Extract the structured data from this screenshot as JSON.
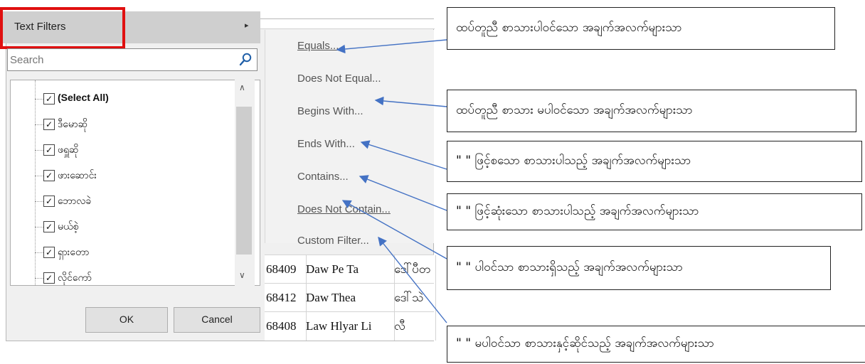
{
  "text_filters": {
    "label": "Text Filters",
    "arrow": "▸"
  },
  "search": {
    "placeholder": "Search"
  },
  "list_items": [
    {
      "label": "(Select All)",
      "checked": true
    },
    {
      "label": "ဒီမောဆို",
      "checked": true
    },
    {
      "label": "ဖရှူဆို",
      "checked": true
    },
    {
      "label": "ဖားဆောင်း",
      "checked": true
    },
    {
      "label": "ဘောလခဲ",
      "checked": true
    },
    {
      "label": "မယ်စဲ့",
      "checked": true
    },
    {
      "label": "ရှားတော",
      "checked": true
    },
    {
      "label": "လိုင်ကော်",
      "checked": true
    }
  ],
  "buttons": {
    "ok": "OK",
    "cancel": "Cancel"
  },
  "submenu": [
    {
      "label": "Equals..."
    },
    {
      "label": "Does Not Equal..."
    },
    {
      "label": "Begins With..."
    },
    {
      "label": "Ends With..."
    },
    {
      "label": "Contains..."
    },
    {
      "label": "Does Not Contain..."
    },
    {
      "label": "Custom Filter..."
    }
  ],
  "rows": [
    {
      "id": "68409",
      "name": "Daw Pe Ta",
      "mm": "ဒေါ်ပီတ"
    },
    {
      "id": "68412",
      "name": "Daw Thea",
      "mm": "ဒေါ်သဲ"
    },
    {
      "id": "68408",
      "name": "Law Hlyar Li",
      "mm": "လီ"
    }
  ],
  "callouts": [
    "ထပ်တူညီ စာသားပါဝင်သော အချက်အလက်များသာ",
    "ထပ်တူညီ စာသား မပါဝင်သော အချက်အလက်များသာ",
    "\" \" ဖြင့်စသော စာသားပါသည့် အချက်အလက်များသာ",
    "\" \" ဖြင့်ဆုံးသော စာသားပါသည့် အချက်အလက်များသာ",
    "\" \" ပါဝင်သာ စာသားရှိသည့် အချက်အလက်များသာ",
    "\" \" မပါဝင်သာ စာသားနှင့်ဆိုင်သည့် အချက်အလက်များသာ"
  ],
  "colors": {
    "highlight_box": "#e01010",
    "arrow": "#4472c4"
  }
}
